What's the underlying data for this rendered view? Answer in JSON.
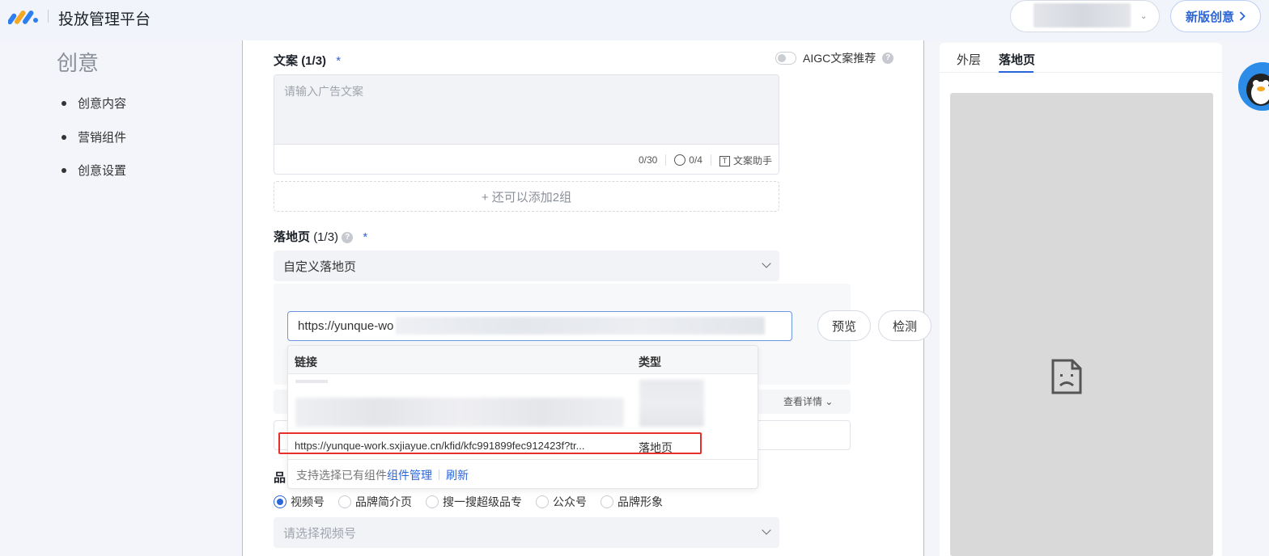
{
  "header": {
    "app_title": "投放管理平台",
    "new_creative_label": "新版创意"
  },
  "left_nav": {
    "title": "创意",
    "items": [
      {
        "label": "创意内容"
      },
      {
        "label": "营销组件"
      },
      {
        "label": "创意设置"
      }
    ]
  },
  "copy_section": {
    "label": "文案",
    "count": "(1/3)",
    "required_mark": "*",
    "aigc_label": "AIGC文案推荐",
    "placeholder": "请输入广告文案",
    "char_count": "0/30",
    "emoji_count": "0/4",
    "assistant_label": "文案助手",
    "add_group_label": "+ 还可以添加2组"
  },
  "landing_section": {
    "label": "落地页",
    "count": "(1/3)",
    "required_mark": "*",
    "select_value": "自定义落地页",
    "url_value": "https://yunque-wo",
    "preview_button": "预览",
    "check_button": "检测",
    "detail_link": "查看详情"
  },
  "dropdown": {
    "col_link": "链接",
    "col_type": "类型",
    "row_url": "https://yunque-work.sxjiayue.cn/kfid/kfc991899fec912423f?tr...",
    "row_type": "落地页",
    "footer_text": "支持选择已有组件",
    "footer_link_manage": "组件管理",
    "footer_link_refresh": "刷新"
  },
  "brand_section": {
    "label": "品",
    "options": [
      {
        "label": "视频号",
        "checked": true
      },
      {
        "label": "品牌简介页",
        "checked": false
      },
      {
        "label": "搜一搜超级品专",
        "checked": false
      },
      {
        "label": "公众号",
        "checked": false
      },
      {
        "label": "品牌形象",
        "checked": false
      }
    ],
    "select_placeholder": "请选择视频号"
  },
  "preview_panel": {
    "tabs": [
      "外层",
      "落地页"
    ],
    "active_tab": "落地页"
  },
  "colors": {
    "accent": "#2b66d9",
    "highlight": "#e8302b"
  }
}
